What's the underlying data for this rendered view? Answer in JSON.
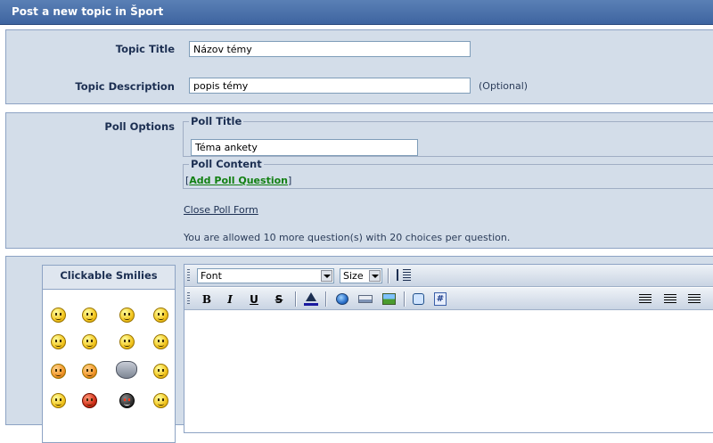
{
  "window": {
    "title": "Post a new topic in Šport"
  },
  "topic": {
    "title_label": "Topic Title",
    "title_value": "Názov témy",
    "desc_label": "Topic Description",
    "desc_value": "popis témy",
    "desc_optional": "(Optional)"
  },
  "poll": {
    "options_label": "Poll Options",
    "title_legend": "Poll Title",
    "title_value": "Téma ankety",
    "content_legend": "Poll Content",
    "add_question": "Add Poll Question",
    "close_form": "Close Poll Form",
    "allowed_text": "You are allowed 10 more question(s) with 20 choices per question."
  },
  "smilies": {
    "heading": "Clickable Smilies"
  },
  "editor": {
    "font_select": "Font",
    "size_select": "Size",
    "bold": "B",
    "italic": "I",
    "underline": "U",
    "strike": "S"
  },
  "colors": {
    "titlebar": "#3e64a0",
    "panel": "#d3dde9",
    "link_green": "#128012"
  }
}
